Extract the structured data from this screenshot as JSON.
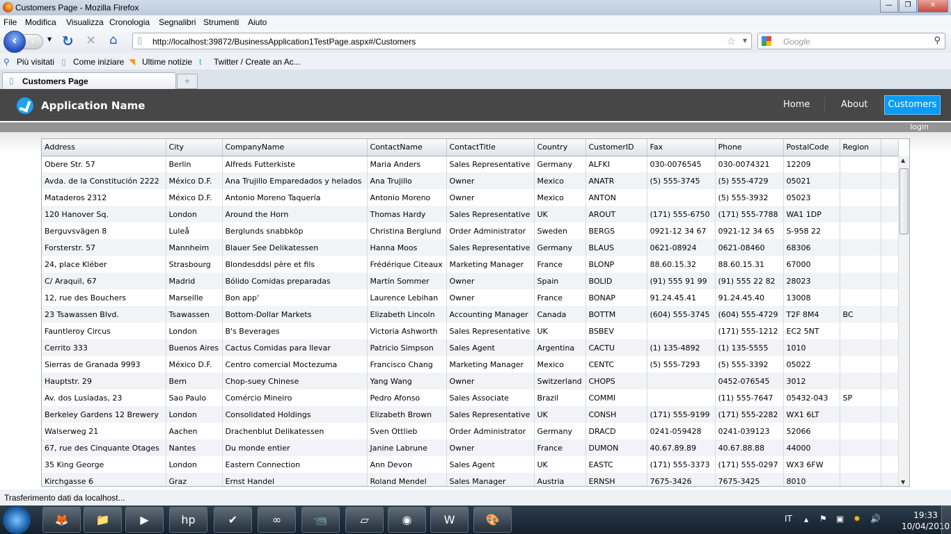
{
  "window": {
    "title": "Customers Page - Mozilla Firefox"
  },
  "menu": [
    "File",
    "Modifica",
    "Visualizza",
    "Cronologia",
    "Segnalibri",
    "Strumenti",
    "Aiuto"
  ],
  "address": {
    "url": "http://localhost:39872/BusinessApplication1TestPage.aspx#/Customers",
    "search_placeholder": "Google"
  },
  "bookmarks": [
    "Più visitati",
    "Come iniziare",
    "Ultime notizie",
    "Twitter / Create an Ac..."
  ],
  "tab": {
    "title": "Customers Page",
    "new_tab": "+"
  },
  "app": {
    "name": "Application Name",
    "nav": [
      "Home",
      "About",
      "Customers"
    ],
    "selected": "Customers",
    "login": "login",
    "accent": "#0a9cf5"
  },
  "grid": {
    "columns": [
      "Address",
      "City",
      "CompanyName",
      "ContactName",
      "ContactTitle",
      "Country",
      "CustomerID",
      "Fax",
      "Phone",
      "PostalCode",
      "Region"
    ],
    "rows": [
      [
        "Obere Str. 57",
        "Berlin",
        "Alfreds Futterkiste",
        "Maria Anders",
        "Sales Representative",
        "Germany",
        "ALFKI",
        "030-0076545",
        "030-0074321",
        "12209",
        ""
      ],
      [
        "Avda. de la Constitución 2222",
        "México D.F.",
        "Ana Trujillo Emparedados y helados",
        "Ana Trujillo",
        "Owner",
        "Mexico",
        "ANATR",
        "(5) 555-3745",
        "(5) 555-4729",
        "05021",
        ""
      ],
      [
        "Mataderos  2312",
        "México D.F.",
        "Antonio Moreno Taquería",
        "Antonio Moreno",
        "Owner",
        "Mexico",
        "ANTON",
        "",
        "(5) 555-3932",
        "05023",
        ""
      ],
      [
        "120 Hanover Sq.",
        "London",
        "Around the Horn",
        "Thomas Hardy",
        "Sales Representative",
        "UK",
        "AROUT",
        "(171) 555-6750",
        "(171) 555-7788",
        "WA1 1DP",
        ""
      ],
      [
        "Berguvsvägen  8",
        "Luleå",
        "Berglunds snabbköp",
        "Christina Berglund",
        "Order Administrator",
        "Sweden",
        "BERGS",
        "0921-12 34 67",
        "0921-12 34 65",
        "S-958 22",
        ""
      ],
      [
        "Forsterstr. 57",
        "Mannheim",
        "Blauer See Delikatessen",
        "Hanna Moos",
        "Sales Representative",
        "Germany",
        "BLAUS",
        "0621-08924",
        "0621-08460",
        "68306",
        ""
      ],
      [
        "24, place Kléber",
        "Strasbourg",
        "Blondesddsl père et fils",
        "Frédérique Citeaux",
        "Marketing Manager",
        "France",
        "BLONP",
        "88.60.15.32",
        "88.60.15.31",
        "67000",
        ""
      ],
      [
        "C/ Araquil, 67",
        "Madrid",
        "Bólido Comidas preparadas",
        "Martín Sommer",
        "Owner",
        "Spain",
        "BOLID",
        "(91) 555 91 99",
        "(91) 555 22 82",
        "28023",
        ""
      ],
      [
        "12, rue des Bouchers",
        "Marseille",
        "Bon app'",
        "Laurence Lebihan",
        "Owner",
        "France",
        "BONAP",
        "91.24.45.41",
        "91.24.45.40",
        "13008",
        ""
      ],
      [
        "23 Tsawassen Blvd.",
        "Tsawassen",
        "Bottom-Dollar Markets",
        "Elizabeth Lincoln",
        "Accounting Manager",
        "Canada",
        "BOTTM",
        "(604) 555-3745",
        "(604) 555-4729",
        "T2F 8M4",
        "BC"
      ],
      [
        "Fauntleroy Circus",
        "London",
        "B's Beverages",
        "Victoria Ashworth",
        "Sales Representative",
        "UK",
        "BSBEV",
        "",
        "(171) 555-1212",
        "EC2 5NT",
        ""
      ],
      [
        "Cerrito 333",
        "Buenos Aires",
        "Cactus Comidas para llevar",
        "Patricio Simpson",
        "Sales Agent",
        "Argentina",
        "CACTU",
        "(1) 135-4892",
        "(1) 135-5555",
        "1010",
        ""
      ],
      [
        "Sierras de Granada 9993",
        "México D.F.",
        "Centro comercial Moctezuma",
        "Francisco Chang",
        "Marketing Manager",
        "Mexico",
        "CENTC",
        "(5) 555-7293",
        "(5) 555-3392",
        "05022",
        ""
      ],
      [
        "Hauptstr. 29",
        "Bern",
        "Chop-suey Chinese",
        "Yang Wang",
        "Owner",
        "Switzerland",
        "CHOPS",
        "",
        "0452-076545",
        "3012",
        ""
      ],
      [
        "Av. dos Lusíadas, 23",
        "Sao Paulo",
        "Comércio Mineiro",
        "Pedro Afonso",
        "Sales Associate",
        "Brazil",
        "COMMI",
        "",
        "(11) 555-7647",
        "05432-043",
        "SP"
      ],
      [
        "Berkeley Gardens 12  Brewery",
        "London",
        "Consolidated Holdings",
        "Elizabeth Brown",
        "Sales Representative",
        "UK",
        "CONSH",
        "(171) 555-9199",
        "(171) 555-2282",
        "WX1 6LT",
        ""
      ],
      [
        "Walserweg 21",
        "Aachen",
        "Drachenblut Delikatessen",
        "Sven Ottlieb",
        "Order Administrator",
        "Germany",
        "DRACD",
        "0241-059428",
        "0241-039123",
        "52066",
        ""
      ],
      [
        "67, rue des Cinquante Otages",
        "Nantes",
        "Du monde entier",
        "Janine Labrune",
        "Owner",
        "France",
        "DUMON",
        "40.67.89.89",
        "40.67.88.88",
        "44000",
        ""
      ],
      [
        "35 King George",
        "London",
        "Eastern Connection",
        "Ann Devon",
        "Sales Agent",
        "UK",
        "EASTC",
        "(171) 555-3373",
        "(171) 555-0297",
        "WX3 6FW",
        ""
      ],
      [
        "Kirchgasse 6",
        "Graz",
        "Ernst Handel",
        "Roland Mendel",
        "Sales Manager",
        "Austria",
        "ERNSH",
        "7675-3426",
        "7675-3425",
        "8010",
        ""
      ]
    ]
  },
  "status": "Trasferimento dati da localhost...",
  "taskbar": {
    "lang": "IT",
    "time": "19:33",
    "date": "10/04/2010"
  }
}
